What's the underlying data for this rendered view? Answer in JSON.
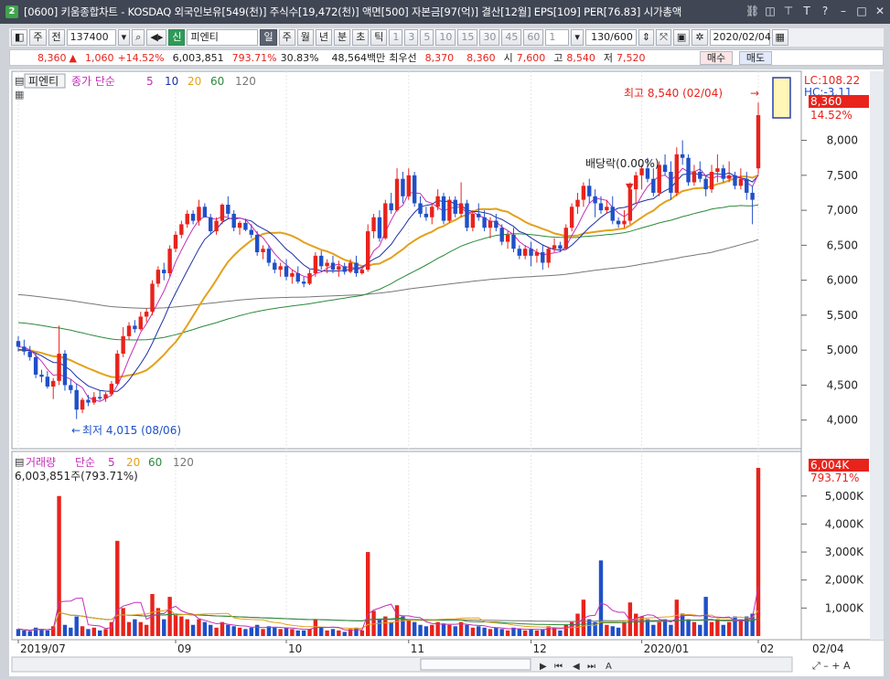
{
  "window": {
    "app_badge": "2",
    "title": "[0600] 키움종합차트 - KOSDAQ 외국인보유[549(천)] 주식수[19,472(천)] 액면[500] 자본금[97(억)] 결산[12월] EPS[109] PER[76.83] 시가총액"
  },
  "toolbar": {
    "period_week": "주",
    "prev_label": "전",
    "code": "137400",
    "new_badge": "신",
    "name": "피엔티",
    "periods": [
      "일",
      "주",
      "월",
      "년",
      "분",
      "초",
      "틱"
    ],
    "minutes": [
      "1",
      "3",
      "5",
      "10",
      "15",
      "30",
      "45",
      "60"
    ],
    "count_select": "1",
    "count_display": "130/600",
    "date": "2020/02/04"
  },
  "price_bar": {
    "current": "8,360",
    "change_arrow": "▲",
    "change": "1,060",
    "change_pct": "+14.52%",
    "volume": "6,003,851",
    "volume_ratio": "793.71%",
    "turnover_pct": "30.83%",
    "amount": "48,564백만",
    "priority_label": "최우선",
    "ask": "8,370",
    "bid": "8,360",
    "open_label": "시",
    "open": "7,600",
    "high_label": "고",
    "high": "8,540",
    "low_label": "저",
    "low": "7,520",
    "buy_button": "매수",
    "sell_button": "매도"
  },
  "price_panel": {
    "stock_tag": "피엔티",
    "legend_label": "종가 단순",
    "ma_periods": [
      "5",
      "10",
      "20",
      "60",
      "120"
    ],
    "lc_label": "LC:108.22",
    "hc_label": "HC:-3.11",
    "current_tag": "8,360",
    "change_pct_tag": "14.52%",
    "high_annotation": "최고 8,540 (02/04)",
    "low_annotation": "최저 4,015 (08/06)",
    "dividend_annotation": "배당락(0.00%)"
  },
  "volume_panel": {
    "legend_label": "거래량",
    "legend_sub": "단순",
    "ma_periods": [
      "5",
      "20",
      "60",
      "120"
    ],
    "value_line": "6,003,851주(793.71%)",
    "current_tag": "6,004K",
    "pct_tag": "793.71%"
  },
  "footer": {
    "last_date": "02/04"
  },
  "colors": {
    "up": "#e8231c",
    "down": "#1f50c8",
    "ma5": "#c42fb8",
    "ma10": "#1c2fa8",
    "ma20": "#e3a11b",
    "ma60": "#2a8a3a",
    "ma120": "#777777"
  },
  "chart_data": [
    {
      "type": "candlestick",
      "title": "피엔티 (137400) 일봉",
      "ylim": [
        3800,
        8700
      ],
      "y_ticks": [
        4000,
        4500,
        5000,
        5500,
        6000,
        6500,
        7000,
        7500,
        8000
      ],
      "x_ticks": [
        "2019/07",
        "09",
        "10",
        "11",
        "12",
        "2020/01",
        "02"
      ],
      "x_tick_index": [
        0,
        27,
        46,
        67,
        88,
        107,
        127
      ],
      "ohlc": [
        [
          5130,
          5200,
          4980,
          5050
        ],
        [
          5050,
          5150,
          4930,
          4980
        ],
        [
          4980,
          5060,
          4850,
          4900
        ],
        [
          4900,
          4960,
          4600,
          4650
        ],
        [
          4650,
          4720,
          4540,
          4620
        ],
        [
          4620,
          4700,
          4450,
          4480
        ],
        [
          4480,
          4600,
          4300,
          4560
        ],
        [
          4560,
          5350,
          4500,
          4950
        ],
        [
          4950,
          5000,
          4420,
          4500
        ],
        [
          4500,
          4580,
          4380,
          4430
        ],
        [
          4430,
          4520,
          4015,
          4150
        ],
        [
          4150,
          4320,
          4100,
          4290
        ],
        [
          4290,
          4360,
          4200,
          4250
        ],
        [
          4250,
          4400,
          4220,
          4330
        ],
        [
          4330,
          4420,
          4280,
          4310
        ],
        [
          4310,
          4400,
          4260,
          4370
        ],
        [
          4370,
          4560,
          4340,
          4520
        ],
        [
          4520,
          5000,
          4500,
          4950
        ],
        [
          4950,
          5330,
          4900,
          5200
        ],
        [
          5200,
          5400,
          5150,
          5350
        ],
        [
          5350,
          5430,
          5250,
          5300
        ],
        [
          5300,
          5550,
          5280,
          5480
        ],
        [
          5480,
          5600,
          5400,
          5550
        ],
        [
          5550,
          6000,
          5500,
          5950
        ],
        [
          5950,
          6200,
          5900,
          6150
        ],
        [
          6150,
          6250,
          6000,
          6100
        ],
        [
          6100,
          6500,
          6050,
          6450
        ],
        [
          6450,
          6700,
          6400,
          6650
        ],
        [
          6650,
          6850,
          6600,
          6800
        ],
        [
          6800,
          7000,
          6750,
          6950
        ],
        [
          6950,
          7000,
          6800,
          6850
        ],
        [
          6850,
          7150,
          6780,
          7050
        ],
        [
          7050,
          7100,
          6900,
          6900
        ],
        [
          6900,
          6950,
          6650,
          6700
        ],
        [
          6700,
          6900,
          6650,
          6850
        ],
        [
          6850,
          7100,
          6800,
          7080
        ],
        [
          7080,
          7200,
          6900,
          6950
        ],
        [
          6950,
          7000,
          6700,
          6750
        ],
        [
          6750,
          6850,
          6650,
          6820
        ],
        [
          6820,
          6880,
          6700,
          6720
        ],
        [
          6720,
          6800,
          6600,
          6650
        ],
        [
          6650,
          6700,
          6350,
          6400
        ],
        [
          6400,
          6500,
          6300,
          6450
        ],
        [
          6450,
          6500,
          6200,
          6250
        ],
        [
          6250,
          6300,
          6100,
          6150
        ],
        [
          6150,
          6250,
          6050,
          6200
        ],
        [
          6200,
          6300,
          6000,
          6050
        ],
        [
          6050,
          6150,
          5950,
          6100
        ],
        [
          6100,
          6200,
          5950,
          5980
        ],
        [
          5980,
          6050,
          5900,
          5950
        ],
        [
          5950,
          6150,
          5930,
          6100
        ],
        [
          6100,
          6400,
          6050,
          6350
        ],
        [
          6350,
          6420,
          6150,
          6200
        ],
        [
          6200,
          6300,
          6100,
          6250
        ],
        [
          6250,
          6350,
          6100,
          6150
        ],
        [
          6150,
          6280,
          6050,
          6200
        ],
        [
          6200,
          6250,
          6080,
          6120
        ],
        [
          6120,
          6300,
          6100,
          6250
        ],
        [
          6250,
          6350,
          6050,
          6100
        ],
        [
          6100,
          6200,
          6080,
          6150
        ],
        [
          6150,
          6800,
          6120,
          6700
        ],
        [
          6700,
          6950,
          6600,
          6900
        ],
        [
          6900,
          7000,
          6550,
          6600
        ],
        [
          6600,
          7150,
          6580,
          7100
        ],
        [
          7100,
          7250,
          6950,
          7000
        ],
        [
          7000,
          7600,
          6980,
          7450
        ],
        [
          7450,
          7550,
          7100,
          7200
        ],
        [
          7200,
          7600,
          7150,
          7500
        ],
        [
          7500,
          7550,
          7050,
          7100
        ],
        [
          7100,
          7200,
          6900,
          6950
        ],
        [
          6950,
          7050,
          6850,
          6900
        ],
        [
          6900,
          7100,
          6800,
          7050
        ],
        [
          7050,
          7300,
          7000,
          7200
        ],
        [
          7200,
          7250,
          6800,
          6850
        ],
        [
          6850,
          7200,
          6820,
          7150
        ],
        [
          7150,
          7200,
          6900,
          6950
        ],
        [
          6950,
          7400,
          6900,
          7100
        ],
        [
          7100,
          7150,
          6700,
          6750
        ],
        [
          6750,
          7000,
          6700,
          6950
        ],
        [
          6950,
          7100,
          6850,
          6900
        ],
        [
          6900,
          7000,
          6700,
          6750
        ],
        [
          6750,
          6900,
          6600,
          6850
        ],
        [
          6850,
          6950,
          6700,
          6750
        ],
        [
          6750,
          6800,
          6500,
          6550
        ],
        [
          6550,
          6700,
          6450,
          6650
        ],
        [
          6650,
          6750,
          6400,
          6450
        ],
        [
          6450,
          6500,
          6300,
          6350
        ],
        [
          6350,
          6500,
          6300,
          6450
        ],
        [
          6450,
          6550,
          6200,
          6350
        ],
        [
          6350,
          6450,
          6250,
          6400
        ],
        [
          6400,
          6500,
          6150,
          6250
        ],
        [
          6250,
          6480,
          6180,
          6450
        ],
        [
          6450,
          6600,
          6400,
          6500
        ],
        [
          6500,
          6550,
          6400,
          6450
        ],
        [
          6450,
          6800,
          6450,
          6750
        ],
        [
          6750,
          7100,
          6700,
          7050
        ],
        [
          7050,
          7250,
          6950,
          7150
        ],
        [
          7150,
          7400,
          7050,
          7350
        ],
        [
          7350,
          7450,
          7100,
          7200
        ],
        [
          7200,
          7300,
          6900,
          7100
        ],
        [
          7100,
          7200,
          6950,
          7000
        ],
        [
          7000,
          7150,
          6950,
          7050
        ],
        [
          7050,
          7200,
          6800,
          6850
        ],
        [
          6850,
          6900,
          6750,
          6800
        ],
        [
          6800,
          7000,
          6750,
          6850
        ],
        [
          6850,
          7400,
          6800,
          7300
        ],
        [
          7300,
          7550,
          7100,
          7500
        ],
        [
          7500,
          7650,
          7300,
          7600
        ],
        [
          7600,
          7750,
          7400,
          7450
        ],
        [
          7450,
          7600,
          7200,
          7250
        ],
        [
          7250,
          7700,
          7200,
          7650
        ],
        [
          7650,
          7800,
          7500,
          7550
        ],
        [
          7550,
          7700,
          7150,
          7250
        ],
        [
          7250,
          7900,
          7200,
          7800
        ],
        [
          7800,
          8000,
          7650,
          7750
        ],
        [
          7750,
          7800,
          7350,
          7400
        ],
        [
          7400,
          7650,
          7350,
          7550
        ],
        [
          7550,
          7700,
          7400,
          7450
        ],
        [
          7450,
          7500,
          7200,
          7300
        ],
        [
          7300,
          7650,
          7250,
          7550
        ],
        [
          7550,
          7800,
          7400,
          7600
        ],
        [
          7600,
          7650,
          7400,
          7450
        ],
        [
          7450,
          7700,
          7400,
          7500
        ],
        [
          7500,
          7550,
          7300,
          7350
        ],
        [
          7350,
          7600,
          7300,
          7450
        ],
        [
          7450,
          7550,
          7150,
          7250
        ],
        [
          7250,
          7350,
          6800,
          7150
        ],
        [
          7600,
          8540,
          7520,
          8360
        ]
      ],
      "ma_values_at_end": {
        "ma5": 7600,
        "ma10": 7550,
        "ma20": 7560,
        "ma60": 7100,
        "ma120": 6620
      },
      "annotations": [
        "최고 8,540 (02/04)",
        "최저 4,015 (08/06)",
        "배당락(0.00%)"
      ]
    },
    {
      "type": "bar",
      "title": "거래량",
      "ylim": [
        0,
        6200000
      ],
      "y_ticks": [
        "1,000K",
        "2,000K",
        "3,000K",
        "4,000K",
        "5,000K"
      ],
      "y_tick_values": [
        1000000,
        2000000,
        3000000,
        4000000,
        5000000
      ],
      "values": [
        250000,
        200000,
        180000,
        300000,
        250000,
        200000,
        350000,
        5000000,
        400000,
        300000,
        700000,
        350000,
        250000,
        300000,
        200000,
        250000,
        500000,
        3400000,
        1000000,
        500000,
        600000,
        500000,
        400000,
        1500000,
        1000000,
        600000,
        1400000,
        800000,
        700000,
        600000,
        400000,
        600000,
        500000,
        400000,
        300000,
        500000,
        400000,
        350000,
        300000,
        250000,
        300000,
        400000,
        250000,
        350000,
        300000,
        250000,
        300000,
        250000,
        200000,
        200000,
        250000,
        600000,
        300000,
        200000,
        250000,
        200000,
        150000,
        250000,
        300000,
        200000,
        3000000,
        900000,
        600000,
        700000,
        500000,
        1100000,
        700000,
        600000,
        500000,
        400000,
        350000,
        400000,
        500000,
        450000,
        400000,
        350000,
        500000,
        400000,
        300000,
        350000,
        300000,
        250000,
        300000,
        250000,
        200000,
        300000,
        250000,
        200000,
        250000,
        200000,
        250000,
        350000,
        300000,
        200000,
        400000,
        500000,
        800000,
        1300000,
        600000,
        500000,
        2700000,
        400000,
        350000,
        300000,
        500000,
        1200000,
        800000,
        700000,
        600000,
        400000,
        500000,
        600000,
        400000,
        1300000,
        800000,
        600000,
        500000,
        400000,
        1400000,
        500000,
        600000,
        400000,
        500000,
        700000,
        600000,
        700000,
        800000,
        6003851
      ],
      "avg_lines": [
        "5",
        "20",
        "60",
        "120"
      ]
    }
  ]
}
